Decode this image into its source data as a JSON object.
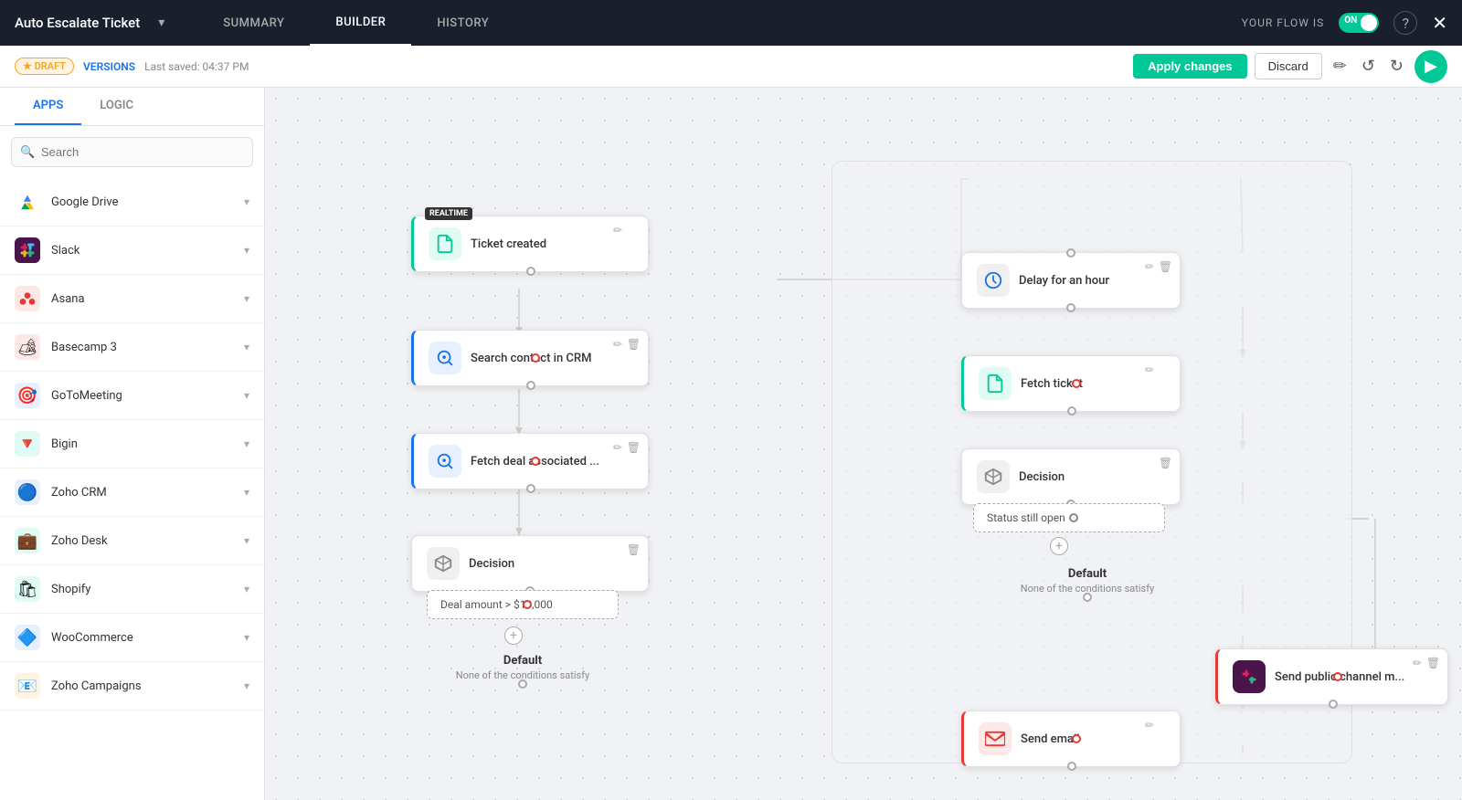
{
  "header": {
    "title": "Auto Escalate Ticket",
    "chevron": "▾",
    "tabs": [
      {
        "label": "SUMMARY",
        "active": false
      },
      {
        "label": "BUILDER",
        "active": true
      },
      {
        "label": "HISTORY",
        "active": false
      }
    ],
    "flow_label": "YOUR FLOW IS",
    "toggle_text": "ON",
    "help_label": "?",
    "close_label": "✕"
  },
  "toolbar": {
    "draft_label": "★ DRAFT",
    "versions_label": "VERSIONS",
    "last_saved": "Last saved: 04:37 PM",
    "apply_label": "Apply changes",
    "discard_label": "Discard",
    "edit_icon": "✏",
    "undo_icon": "↺",
    "redo_icon": "↻"
  },
  "sidebar": {
    "tabs": [
      {
        "label": "APPS",
        "active": true
      },
      {
        "label": "LOGIC",
        "active": false
      }
    ],
    "search_placeholder": "Search",
    "apps": [
      {
        "name": "Google Drive",
        "icon": "🔷"
      },
      {
        "name": "Slack",
        "icon": "💬"
      },
      {
        "name": "Asana",
        "icon": "⬡"
      },
      {
        "name": "Basecamp 3",
        "icon": "⛺"
      },
      {
        "name": "GoToMeeting",
        "icon": "🎯"
      },
      {
        "name": "Bigin",
        "icon": "▽"
      },
      {
        "name": "Zoho CRM",
        "icon": "🔵"
      },
      {
        "name": "Zoho Desk",
        "icon": "💼"
      },
      {
        "name": "Shopify",
        "icon": "🛍"
      },
      {
        "name": "WooCommerce",
        "icon": "🔷"
      },
      {
        "name": "Zoho Campaigns",
        "icon": "📧"
      }
    ]
  },
  "canvas": {
    "nodes": {
      "ticket_created": {
        "label": "Ticket created",
        "realtime": "REALTIME"
      },
      "search_contact": {
        "label": "Search contact in CRM"
      },
      "fetch_deal": {
        "label": "Fetch deal associated ..."
      },
      "decision1": {
        "label": "Decision"
      },
      "deal_condition": {
        "label": "Deal amount > $10,000"
      },
      "default1": {
        "bold": "Default",
        "sub": "None of the conditions satisfy"
      },
      "delay": {
        "label": "Delay for an hour"
      },
      "fetch_ticket": {
        "label": "Fetch ticket"
      },
      "decision2": {
        "label": "Decision"
      },
      "status_condition": {
        "label": "Status still open"
      },
      "default2": {
        "bold": "Default",
        "sub": "None of the conditions satisfy"
      },
      "send_public": {
        "label": "Send public channel m..."
      },
      "send_email": {
        "label": "Send email"
      }
    }
  }
}
